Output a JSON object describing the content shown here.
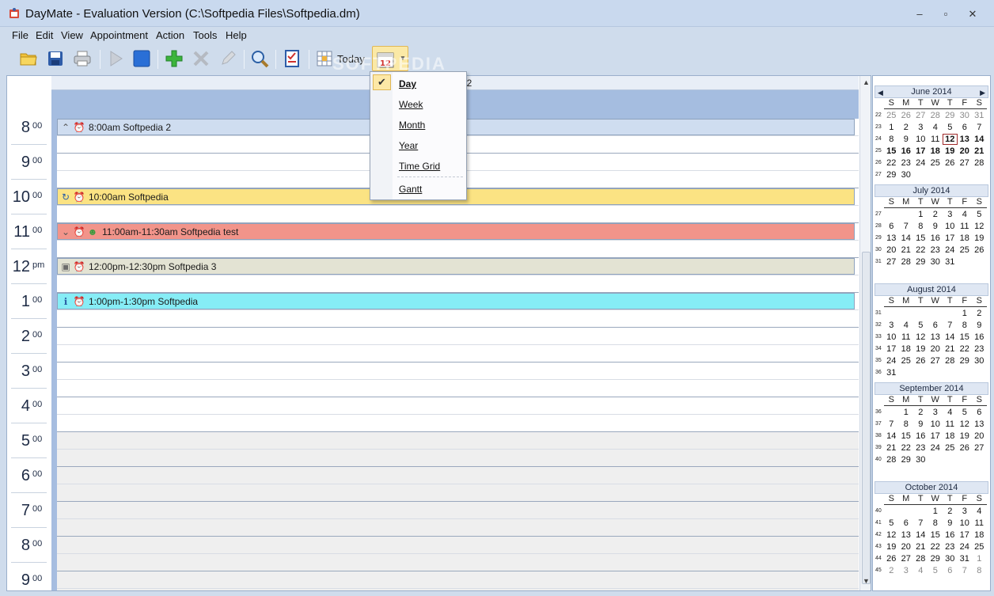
{
  "window": {
    "title": "DayMate - Evaluation Version (C:\\Softpedia Files\\Softpedia.dm)",
    "minimize": "‒",
    "restore": "▫",
    "close": "✕"
  },
  "menu": [
    "File",
    "Edit",
    "View",
    "Appointment",
    "Action",
    "Tools",
    "Help"
  ],
  "toolbar": {
    "today_label": "Today",
    "view_day_icon": "12"
  },
  "watermark": "SOFTPEDIA",
  "day_view": {
    "date_header": "June 12",
    "hours": [
      {
        "num": "8",
        "sfx": "00"
      },
      {
        "num": "9",
        "sfx": "00"
      },
      {
        "num": "10",
        "sfx": "00"
      },
      {
        "num": "11",
        "sfx": "00"
      },
      {
        "num": "12",
        "sfx": "pm"
      },
      {
        "num": "1",
        "sfx": "00"
      },
      {
        "num": "2",
        "sfx": "00"
      },
      {
        "num": "3",
        "sfx": "00"
      },
      {
        "num": "4",
        "sfx": "00"
      },
      {
        "num": "5",
        "sfx": "00"
      },
      {
        "num": "6",
        "sfx": "00"
      },
      {
        "num": "7",
        "sfx": "00"
      },
      {
        "num": "8",
        "sfx": "00"
      },
      {
        "num": "9",
        "sfx": "00"
      }
    ],
    "appointments": [
      {
        "label": "8:00am Softpedia 2",
        "color": "#cfddf0"
      },
      {
        "label": "10:00am Softpedia",
        "color": "#fbe383"
      },
      {
        "label": "11:00am-11:30am Softpedia test",
        "color": "#f2948a"
      },
      {
        "label": "12:00pm-12:30pm Softpedia 3",
        "color": "#e3e3d3"
      },
      {
        "label": "1:00pm-1:30pm Softpedia",
        "color": "#86edf6"
      }
    ]
  },
  "view_menu": {
    "items": [
      "Day",
      "Week",
      "Month",
      "Year",
      "Time Grid",
      "Gantt"
    ],
    "selected": "Day"
  },
  "mini_calendars": {
    "dow": [
      "S",
      "M",
      "T",
      "W",
      "T",
      "F",
      "S"
    ],
    "months": [
      {
        "title": "June 2014",
        "nav": true,
        "weeks": [
          {
            "wk": "22",
            "days": [
              "25",
              "26",
              "27",
              "28",
              "29",
              "30",
              "31"
            ]
          },
          {
            "wk": "23",
            "days": [
              "1",
              "2",
              "3",
              "4",
              "5",
              "6",
              "7"
            ]
          },
          {
            "wk": "24",
            "days": [
              "8",
              "9",
              "10",
              "11",
              "12",
              "13",
              "14"
            ]
          },
          {
            "wk": "25",
            "days": [
              "15",
              "16",
              "17",
              "18",
              "19",
              "20",
              "21"
            ]
          },
          {
            "wk": "26",
            "days": [
              "22",
              "23",
              "24",
              "25",
              "26",
              "27",
              "28"
            ]
          },
          {
            "wk": "27",
            "days": [
              "29",
              "30",
              "",
              "",
              "",
              "",
              ""
            ]
          }
        ]
      },
      {
        "title": "July 2014",
        "nav": false,
        "weeks": [
          {
            "wk": "27",
            "days": [
              "",
              "",
              "1",
              "2",
              "3",
              "4",
              "5"
            ]
          },
          {
            "wk": "28",
            "days": [
              "6",
              "7",
              "8",
              "9",
              "10",
              "11",
              "12"
            ]
          },
          {
            "wk": "29",
            "days": [
              "13",
              "14",
              "15",
              "16",
              "17",
              "18",
              "19"
            ]
          },
          {
            "wk": "30",
            "days": [
              "20",
              "21",
              "22",
              "23",
              "24",
              "25",
              "26"
            ]
          },
          {
            "wk": "31",
            "days": [
              "27",
              "28",
              "29",
              "30",
              "31",
              "",
              ""
            ]
          }
        ]
      },
      {
        "title": "August 2014",
        "nav": false,
        "weeks": [
          {
            "wk": "31",
            "days": [
              "",
              "",
              "",
              "",
              "",
              "1",
              "2"
            ]
          },
          {
            "wk": "32",
            "days": [
              "3",
              "4",
              "5",
              "6",
              "7",
              "8",
              "9"
            ]
          },
          {
            "wk": "33",
            "days": [
              "10",
              "11",
              "12",
              "13",
              "14",
              "15",
              "16"
            ]
          },
          {
            "wk": "34",
            "days": [
              "17",
              "18",
              "19",
              "20",
              "21",
              "22",
              "23"
            ]
          },
          {
            "wk": "35",
            "days": [
              "24",
              "25",
              "26",
              "27",
              "28",
              "29",
              "30"
            ]
          },
          {
            "wk": "36",
            "days": [
              "31",
              "",
              "",
              "",
              "",
              "",
              ""
            ]
          }
        ]
      },
      {
        "title": "September 2014",
        "nav": false,
        "weeks": [
          {
            "wk": "36",
            "days": [
              "",
              "1",
              "2",
              "3",
              "4",
              "5",
              "6"
            ]
          },
          {
            "wk": "37",
            "days": [
              "7",
              "8",
              "9",
              "10",
              "11",
              "12",
              "13"
            ]
          },
          {
            "wk": "38",
            "days": [
              "14",
              "15",
              "16",
              "17",
              "18",
              "19",
              "20"
            ]
          },
          {
            "wk": "39",
            "days": [
              "21",
              "22",
              "23",
              "24",
              "25",
              "26",
              "27"
            ]
          },
          {
            "wk": "40",
            "days": [
              "28",
              "29",
              "30",
              "",
              "",
              "",
              ""
            ]
          }
        ]
      },
      {
        "title": "October 2014",
        "nav": false,
        "weeks": [
          {
            "wk": "40",
            "days": [
              "",
              "",
              "",
              "1",
              "2",
              "3",
              "4"
            ]
          },
          {
            "wk": "41",
            "days": [
              "5",
              "6",
              "7",
              "8",
              "9",
              "10",
              "11"
            ]
          },
          {
            "wk": "42",
            "days": [
              "12",
              "13",
              "14",
              "15",
              "16",
              "17",
              "18"
            ]
          },
          {
            "wk": "43",
            "days": [
              "19",
              "20",
              "21",
              "22",
              "23",
              "24",
              "25"
            ]
          },
          {
            "wk": "44",
            "days": [
              "26",
              "27",
              "28",
              "29",
              "30",
              "31",
              "1"
            ]
          },
          {
            "wk": "45",
            "days": [
              "2",
              "3",
              "4",
              "5",
              "6",
              "7",
              "8"
            ]
          }
        ]
      }
    ],
    "today": "12"
  }
}
